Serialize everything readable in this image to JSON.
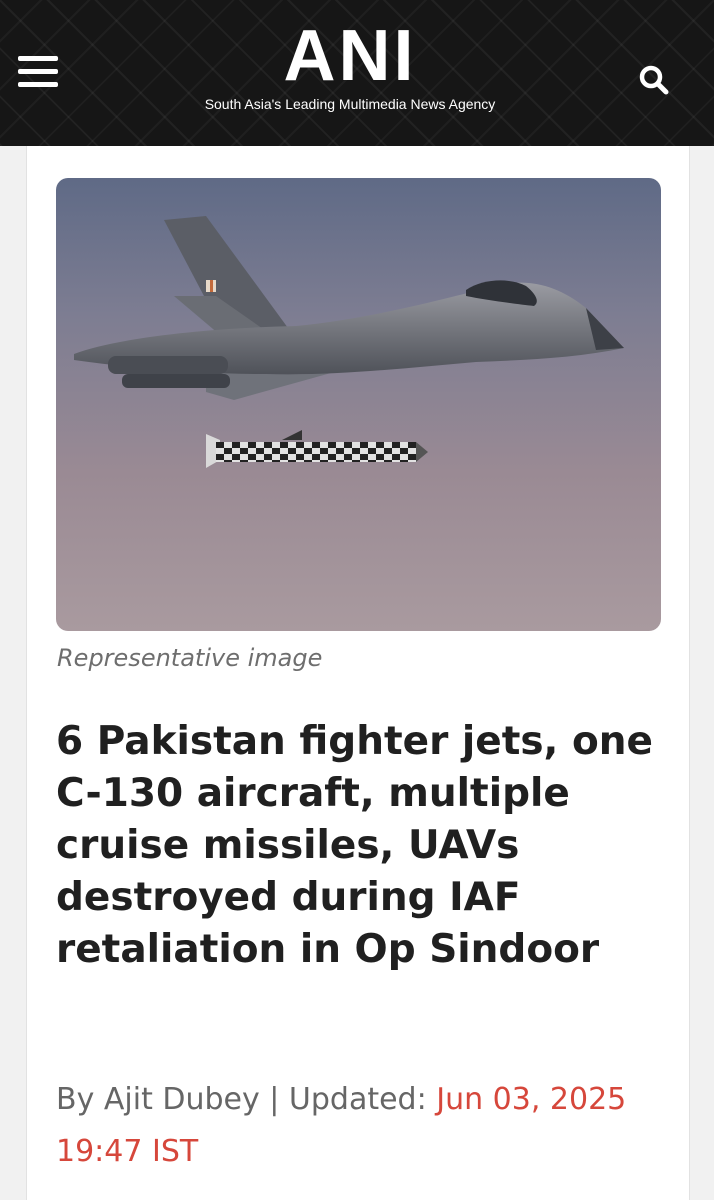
{
  "header": {
    "logo_text": "ANI",
    "tagline": "South Asia's Leading Multimedia News Agency",
    "background_color": "#161616",
    "menu_icon": "hamburger-menu-icon",
    "search_icon": "search-icon"
  },
  "article": {
    "image_caption": "Representative image",
    "headline": "6 Pakistan fighter jets, one C-130 aircraft, multiple cruise missiles, UAVs destroyed during IAF retaliation in Op Sindoor",
    "byline_prefix": "By Ajit Dubey | Updated:",
    "date": "Jun 03, 2025 19:47 IST",
    "date_color": "#d6473b"
  }
}
